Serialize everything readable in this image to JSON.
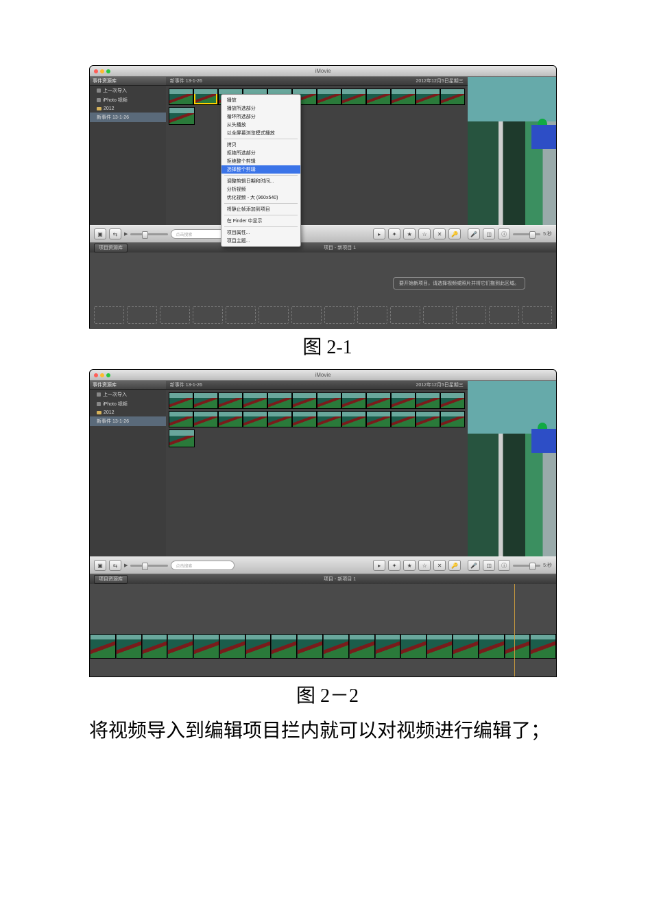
{
  "app": {
    "title": "iMovie",
    "date": "2012年12月5日星期三"
  },
  "sidebar": {
    "header": "事件资源库",
    "items": [
      {
        "label": "上一次导入",
        "icon": "square"
      },
      {
        "label": "iPhoto 视频",
        "icon": "square"
      },
      {
        "label": "2012",
        "icon": "folder"
      },
      {
        "label": "新事件 13-1-26",
        "icon": "none",
        "selected": true
      }
    ]
  },
  "event_header": "新事件 13-1-26",
  "context_menu": {
    "items": [
      {
        "label": "播放"
      },
      {
        "label": "播放所选部分"
      },
      {
        "label": "循环所选部分"
      },
      {
        "label": "从头播放"
      },
      {
        "label": "以全屏幕浏览模式播放"
      },
      {
        "sep": true
      },
      {
        "label": "拷贝"
      },
      {
        "label": "拒绝所选部分"
      },
      {
        "label": "拒绝整个剪辑"
      },
      {
        "label": "选择整个剪辑",
        "highlight": true
      },
      {
        "sep": true
      },
      {
        "label": "调整剪辑日期和时间..."
      },
      {
        "label": "分析视频"
      },
      {
        "label": "优化视频 - 大 (960x540)"
      },
      {
        "sep": true
      },
      {
        "label": "将静止帧添加到项目"
      },
      {
        "sep": true
      },
      {
        "label": "在 Finder 中显示"
      },
      {
        "sep": true
      },
      {
        "label": "项目属性..."
      },
      {
        "label": "项目主题..."
      }
    ]
  },
  "midbar": {
    "search_placeholder": "点击搜索",
    "time_label": "5:秒"
  },
  "projbar": {
    "button": "项目资源库",
    "title": "项目 - 新项目 1"
  },
  "timeline_hint": "要开始新项目，请选择视频或照片并将它们拖到此区域。",
  "captions": {
    "fig1": "图 2-1",
    "fig2": "图 2－2"
  },
  "body_text": "将视频导入到编辑项目拦内就可以对视频进行编辑了；"
}
